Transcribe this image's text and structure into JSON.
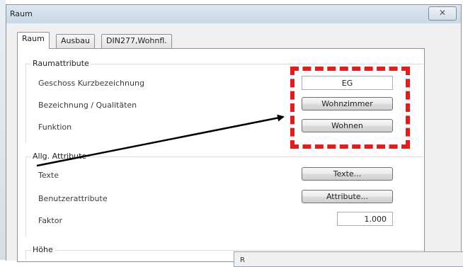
{
  "window": {
    "title": "Raum",
    "close_glyph": "✕"
  },
  "tabs": [
    {
      "label": "Raum",
      "active": true
    },
    {
      "label": "Ausbau",
      "active": false
    },
    {
      "label": "DIN277,Wohnfl.",
      "active": false
    }
  ],
  "groups": {
    "raumattribute": {
      "title": "Raumattribute",
      "rows": [
        {
          "label": "Geschoss Kurzbezeichnung",
          "value": "EG"
        },
        {
          "label": "Bezeichnung / Qualitäten",
          "value": "Wohnzimmer"
        },
        {
          "label": "Funktion",
          "value": "Wohnen"
        }
      ]
    },
    "allg": {
      "title": "Allg. Attribute",
      "rows": [
        {
          "label": "Texte",
          "value": "Texte..."
        },
        {
          "label": "Benutzerattribute",
          "value": "Attribute..."
        },
        {
          "label": "Faktor",
          "value": "1.000"
        }
      ]
    },
    "hoehe": {
      "title": "Höhe"
    }
  },
  "popup": {
    "title": "R"
  },
  "annotation": {
    "callout_color": "#e41b1b",
    "arrow_color": "#000000"
  }
}
